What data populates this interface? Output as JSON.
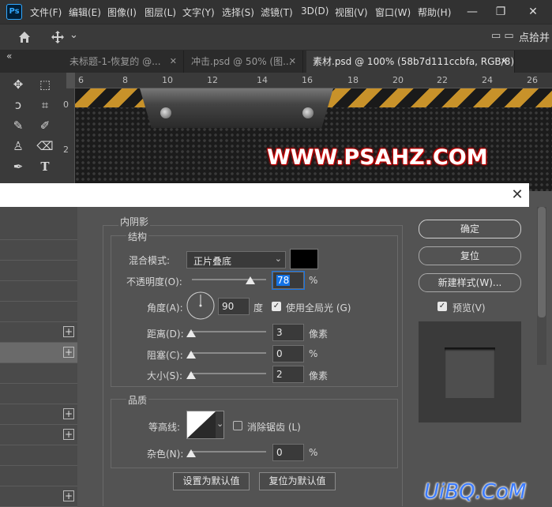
{
  "app": {
    "logo": "Ps"
  },
  "menu": [
    "文件(F)",
    "编辑(E)",
    "图像(I)",
    "图层(L)",
    "文字(Y)",
    "选择(S)",
    "滤镜(T)",
    "3D(D)",
    "视图(V)",
    "窗口(W)",
    "帮助(H)"
  ],
  "window_controls": {
    "minimize": "—",
    "restore": "❐",
    "close": "✕"
  },
  "optionsbar": {
    "home_icon": "home-icon",
    "move_icon": "move-icon",
    "dropdown": "⌄",
    "right_text": "点拾并",
    "extra_icons": "▭ ▭"
  },
  "tabs": [
    {
      "label": "未标题-1-恢复的 @...",
      "close": "✕"
    },
    {
      "label": "冲击.psd @ 50% (图...",
      "close": "✕"
    },
    {
      "label": "素材.psd @ 100% (58b7d111ccbfa, RGB/8) *",
      "close": "✕"
    }
  ],
  "panel_collapse": "«",
  "ruler": {
    "top": [
      "6",
      "8",
      "10",
      "12",
      "14",
      "16",
      "18",
      "20",
      "22",
      "24",
      "26"
    ],
    "left": [
      "0",
      "2"
    ]
  },
  "canvas": {
    "watermark_text": "WWW.PSAHZ.COM"
  },
  "dialog": {
    "close": "✕",
    "section_title": "内阴影",
    "structure": {
      "title": "结构",
      "blend_mode_label": "混合模式:",
      "blend_mode_value": "正片叠底",
      "blend_color": "#000000",
      "opacity_label": "不透明度(O):",
      "opacity_value": "78",
      "opacity_unit": "%",
      "angle_label": "角度(A):",
      "angle_value": "90",
      "angle_unit": "度",
      "global_light_label": "使用全局光 (G)",
      "global_light_checked": true,
      "distance_label": "距离(D):",
      "distance_value": "3",
      "distance_unit": "像素",
      "choke_label": "阻塞(C):",
      "choke_value": "0",
      "choke_unit": "%",
      "size_label": "大小(S):",
      "size_value": "2",
      "size_unit": "像素"
    },
    "quality": {
      "title": "品质",
      "contour_label": "等高线:",
      "antialias_label": "消除锯齿 (L)",
      "antialias_checked": false,
      "noise_label": "杂色(N):",
      "noise_value": "0",
      "noise_unit": "%"
    },
    "buttons": {
      "set_default": "设置为默认值",
      "reset_default": "复位为默认值",
      "ok": "确定",
      "reset": "复位",
      "new_style": "新建样式(W)...",
      "preview": "预览(V)"
    },
    "preview_checked": true
  },
  "bottom_watermark": "UiBQ.CoM",
  "colors": {
    "hazard_yellow": "#c8922a",
    "accent_blue": "#1473e6",
    "watermark_red": "#cc0000"
  }
}
